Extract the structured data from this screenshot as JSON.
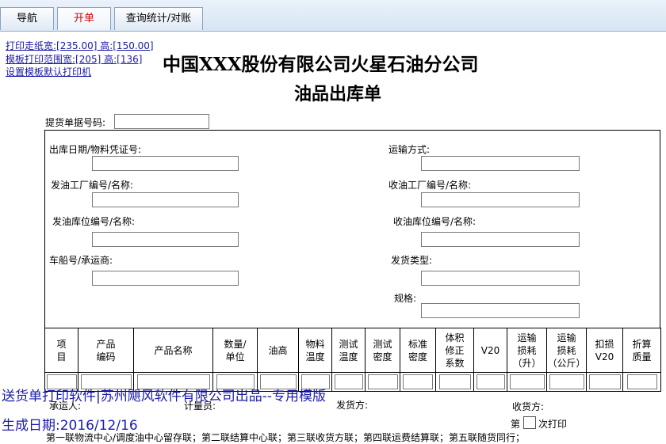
{
  "tabs": {
    "nav": "导航",
    "open": "开单",
    "query": "查询统计/对账"
  },
  "links": {
    "paper": "打印走纸宽:[235.00] 高:[150.00]",
    "range": "模板打印范围宽:[205] 高:[136]",
    "printer": "设置模板默认打印机"
  },
  "header": {
    "company": "中国XXX股份有限公司火星石油分公司",
    "doc_title": "油品出库单"
  },
  "form": {
    "pickup_no": "提货单据号码:",
    "out_date": "出库日期/物料凭证号:",
    "transport": "运输方式:",
    "send_factory": "发油工厂编号/名称:",
    "recv_factory": "收油工厂编号/名称:",
    "send_depot": "发油库位编号/名称:",
    "recv_depot": "收油库位编号/名称:",
    "vehicle": "车船号/承运商:",
    "ship_type": "发货类型:",
    "spec": "规格:"
  },
  "columns": [
    [
      "项",
      "目"
    ],
    [
      "产品",
      "编码"
    ],
    [
      "产品名称"
    ],
    [
      "数量/",
      "单位"
    ],
    [
      "油高"
    ],
    [
      "物料",
      "温度"
    ],
    [
      "测试",
      "温度"
    ],
    [
      "测试",
      "密度"
    ],
    [
      "标准",
      "密度"
    ],
    [
      "体积",
      "修正",
      "系数"
    ],
    [
      "V20"
    ],
    [
      "运输",
      "损耗",
      "（升）"
    ],
    [
      "运输",
      "损耗",
      "（公斤）"
    ],
    [
      "扣损",
      "V20"
    ],
    [
      "折算",
      "质量"
    ]
  ],
  "footer": {
    "carrier": "承运人:",
    "meter": "计量员:",
    "ship_party": "发货方:",
    "recv_party": "收货方:",
    "print_prefix": "第",
    "print_suffix": "次打印",
    "copies": "第一联物流中心/调度油中心留存联；第二联结算中心联；第三联收货方联；第四联运费结算联；第五联随货同行；"
  },
  "overlay": {
    "line1": "送货单打印软件|苏州飓风软件有限公司出品--专用模版",
    "line2": "生成日期:2016/12/16"
  }
}
